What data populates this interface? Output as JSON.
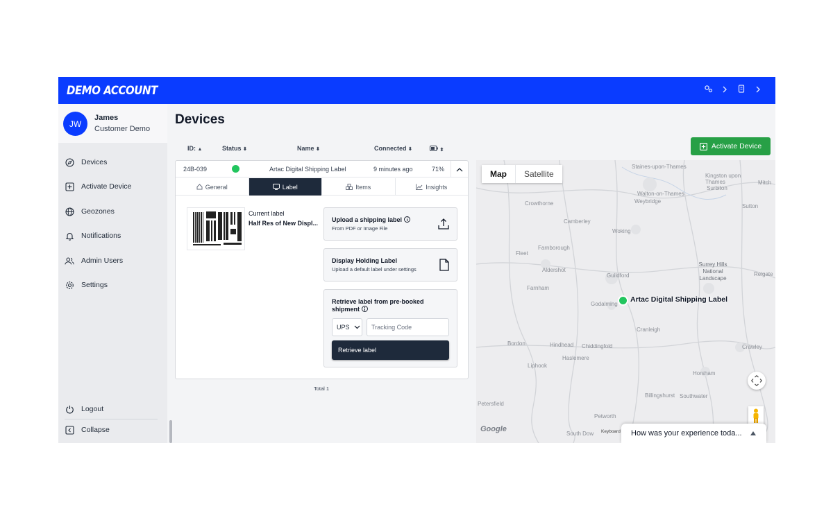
{
  "header": {
    "brand": "DEMO ACCOUNT",
    "brand_color": "#0a3cff",
    "icons": [
      "settings-cogs-icon",
      "chevron-right-icon",
      "device-icon",
      "chevron-right-icon"
    ]
  },
  "user": {
    "initials": "JW",
    "name": "James",
    "org": "Customer Demo"
  },
  "sidebar": {
    "items": [
      {
        "label": "Devices",
        "icon": "compass-icon"
      },
      {
        "label": "Activate Device",
        "icon": "plus-square-icon"
      },
      {
        "label": "Geozones",
        "icon": "globe-icon"
      },
      {
        "label": "Notifications",
        "icon": "bell-icon"
      },
      {
        "label": "Admin Users",
        "icon": "users-icon"
      },
      {
        "label": "Settings",
        "icon": "gear-icon"
      }
    ],
    "logout": "Logout",
    "collapse": "Collapse"
  },
  "main": {
    "title": "Devices",
    "activate_button": "Activate Device",
    "columns": [
      "ID:",
      "Status",
      "Name",
      "Connected"
    ],
    "device": {
      "id": "24B-039",
      "status_color": "#22c55e",
      "name": "Artac Digital Shipping Label",
      "connected": "9 minutes ago",
      "battery": "71%"
    },
    "tabs": [
      {
        "label": "General",
        "icon": "home-icon"
      },
      {
        "label": "Label",
        "icon": "monitor-icon"
      },
      {
        "label": "Items",
        "icon": "boxes-icon"
      },
      {
        "label": "Insights",
        "icon": "chart-line-icon"
      }
    ],
    "active_tab": "Label",
    "current_label": {
      "heading": "Current label",
      "name": "Half Res of New Displ..."
    },
    "upload": {
      "title": "Upload a shipping label",
      "subtitle": "From PDF or Image File"
    },
    "holding": {
      "title": "Display Holding Label",
      "subtitle": "Upload a default label under settings"
    },
    "retrieve": {
      "title": "Retrieve label from pre-booked shipment",
      "carrier": "UPS",
      "tracking_placeholder": "Tracking Code",
      "button": "Retrieve label"
    },
    "total": "Total 1"
  },
  "map": {
    "toggle": [
      "Map",
      "Satellite"
    ],
    "selected": "Map",
    "marker_label": "Artac Digital Shipping Label",
    "towns": [
      "Staines-upon-Thames",
      "Kingston upon Thames",
      "Walton-on-Thames",
      "Surbiton",
      "Weybridge",
      "Mitch",
      "Crowthorne",
      "Camberley",
      "Sutton",
      "Woking",
      "Farnborough",
      "Fleet",
      "Aldershot",
      "Surrey Hills National Landscape",
      "Reigate",
      "Farnham",
      "Guildford",
      "Godalming",
      "Cranleigh",
      "Bordon",
      "Hindhead",
      "Chiddingfold",
      "Crawley",
      "Haslemere",
      "Liphook",
      "Horsham",
      "Billingshurst",
      "Southwater",
      "Petersfield",
      "Petworth",
      "South Dow"
    ],
    "attribution": "Keyboard",
    "google_logo": "Google"
  },
  "feedback": {
    "text": "How was your experience toda..."
  }
}
